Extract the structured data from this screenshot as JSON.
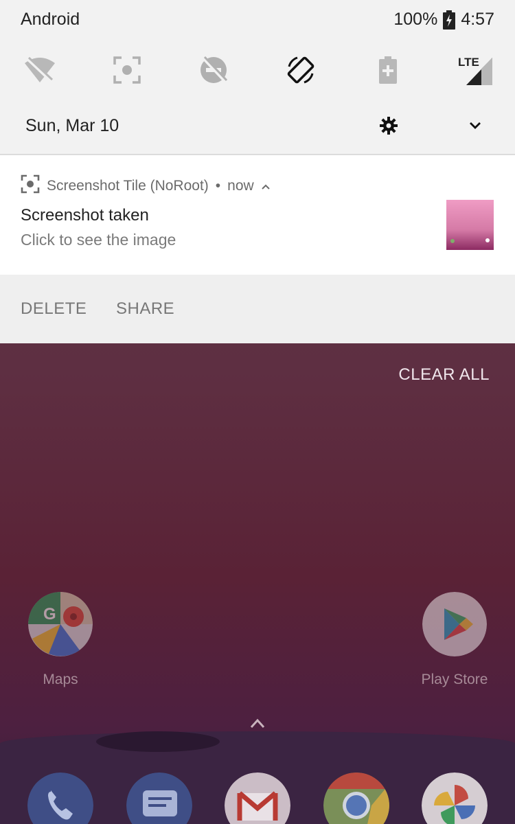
{
  "status_bar": {
    "carrier": "Android",
    "battery": "100%",
    "time": "4:57"
  },
  "quick_settings": [
    {
      "icon": "wifi-off-icon"
    },
    {
      "icon": "screenshot-icon"
    },
    {
      "icon": "do-not-disturb-off-icon"
    },
    {
      "icon": "auto-rotate-icon"
    },
    {
      "icon": "battery-saver-icon"
    },
    {
      "icon": "lte-signal-icon",
      "label": "LTE"
    }
  ],
  "date_row": {
    "date": "Sun, Mar 10"
  },
  "notification": {
    "app_name": "Screenshot Tile (NoRoot)",
    "separator": "•",
    "time": "now",
    "title": "Screenshot taken",
    "body": "Click to see the image",
    "actions": [
      "DELETE",
      "SHARE"
    ]
  },
  "clear_all_label": "CLEAR ALL",
  "home": {
    "apps": [
      {
        "label": "Maps",
        "icon": "maps-icon"
      },
      {
        "label": "Play Store",
        "icon": "play-store-icon"
      }
    ],
    "dock": [
      {
        "icon": "phone-icon"
      },
      {
        "icon": "messages-icon"
      },
      {
        "icon": "gmail-icon"
      },
      {
        "icon": "chrome-icon"
      },
      {
        "icon": "photos-icon"
      }
    ]
  },
  "colors": {
    "shade_background": "#f2f2f2",
    "notification_background": "#ffffff",
    "wallpaper": "#5e2f42"
  }
}
